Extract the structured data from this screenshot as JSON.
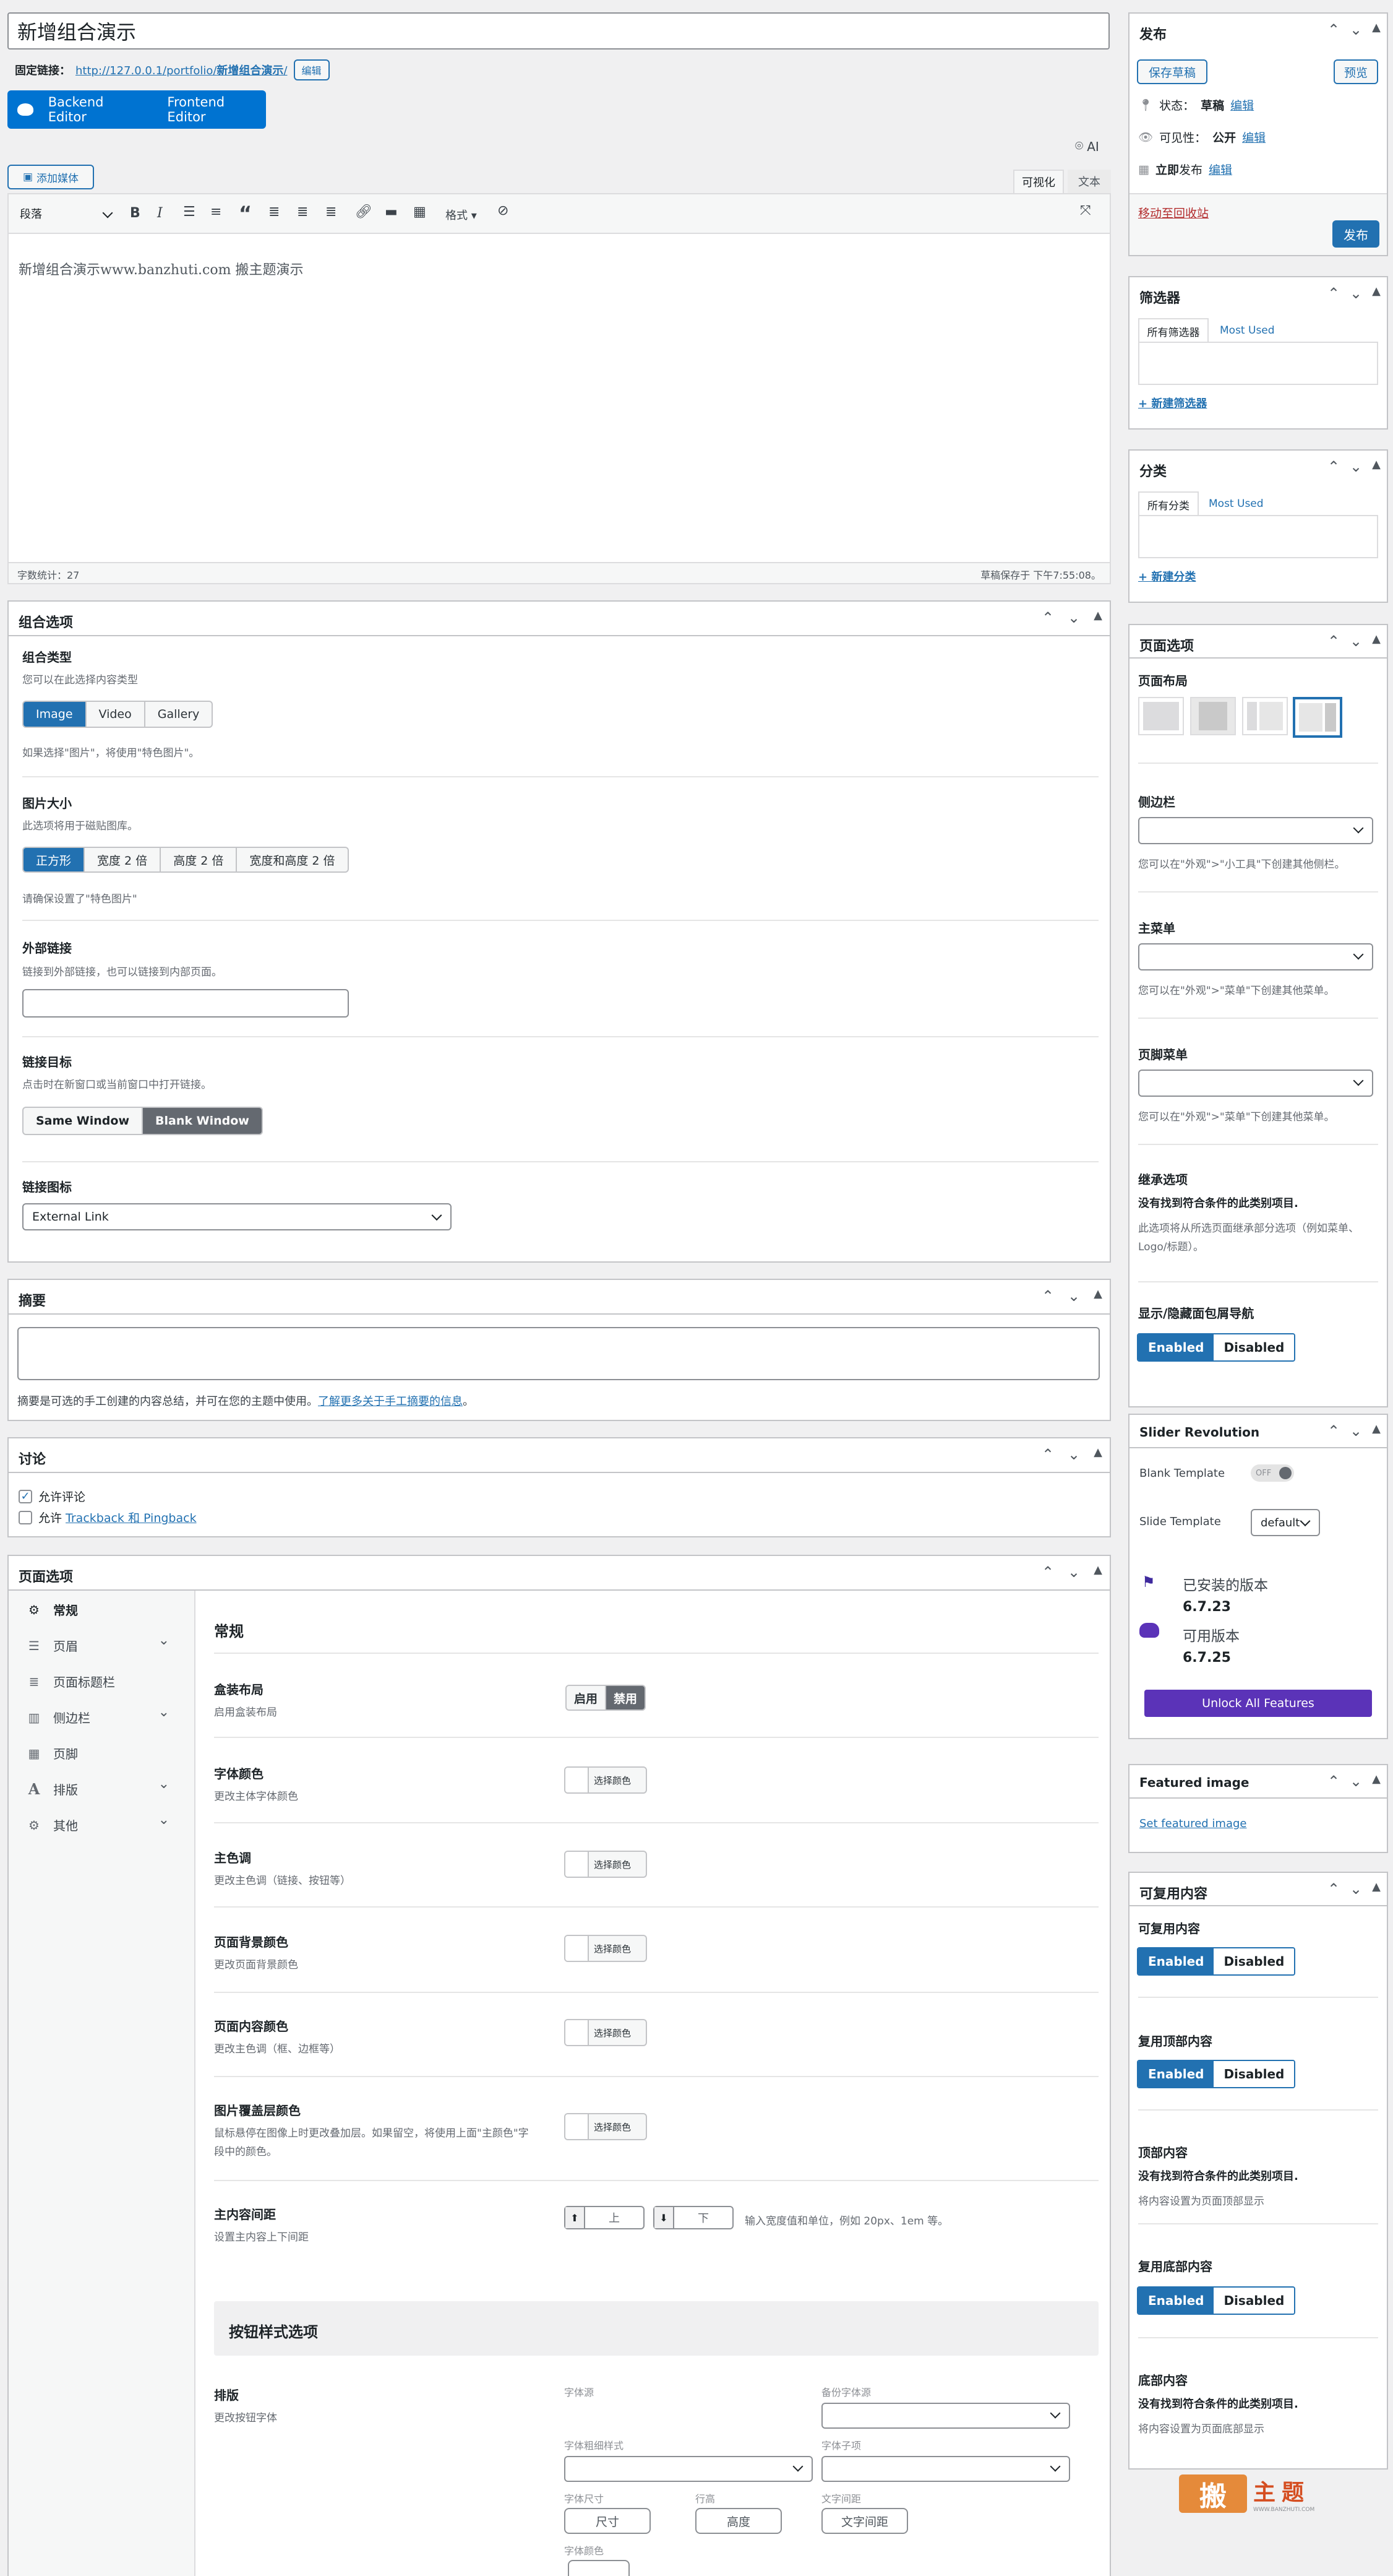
{
  "title_value": "新增组合演示",
  "permalink": {
    "label": "固定链接：",
    "url_prefix": "http://127.0.0.1/portfolio/",
    "url_slug": "新增组合演示",
    "url_suffix": "/",
    "edit": "编辑"
  },
  "builder": {
    "backend": "Backend Editor",
    "frontend": "Frontend Editor",
    "ai": "AI"
  },
  "editor": {
    "add_media": "添加媒体",
    "tab_visual": "可视化",
    "tab_text": "文本",
    "format_select": "段落",
    "more_formats": "格式",
    "content": "新增组合演示www.banzhuti.com 搬主题演示",
    "word_count": "字数统计：27",
    "draft_saved": "草稿保存于 下午7:55:08。"
  },
  "portfolio_options": {
    "title": "组合选项",
    "type": {
      "label": "组合类型",
      "desc": "您可以在此选择内容类型",
      "options": [
        "Image",
        "Video",
        "Gallery"
      ],
      "selected": "Image",
      "note": "如果选择\"图片\"，将使用\"特色图片\"。"
    },
    "image_size": {
      "label": "图片大小",
      "desc": "此选项将用于磁贴图库。",
      "options": [
        "正方形",
        "宽度 2 倍",
        "高度 2 倍",
        "宽度和高度 2 倍"
      ],
      "selected": "正方形",
      "note": "请确保设置了\"特色图片\""
    },
    "external_link": {
      "label": "外部链接",
      "desc": "链接到外部链接，也可以链接到内部页面。",
      "value": ""
    },
    "link_target": {
      "label": "链接目标",
      "desc": "点击时在新窗口或当前窗口中打开链接。",
      "options": [
        "Same Window",
        "Blank Window"
      ],
      "selected": "Blank Window"
    },
    "link_icon": {
      "label": "链接图标",
      "value": "External Link"
    }
  },
  "excerpt": {
    "title": "摘要",
    "help_prefix": "摘要是可选的手工创建的内容总结，并可在您的主题中使用。",
    "help_link": "了解更多关于手工摘要的信息",
    "help_suffix": "。"
  },
  "discussion": {
    "title": "讨论",
    "allow_comments": "允许评论",
    "allow_prefix": "允许 ",
    "allow_link": "Trackback 和 Pingback",
    "comments_checked": true,
    "pings_checked": false
  },
  "page_options_main": {
    "title": "页面选项",
    "nav": [
      {
        "label": "常规",
        "icon": "gear-icon",
        "active": true,
        "chev": false
      },
      {
        "label": "页眉",
        "icon": "sliders-icon",
        "active": false,
        "chev": true
      },
      {
        "label": "页面标题栏",
        "icon": "list-icon",
        "active": false,
        "chev": false
      },
      {
        "label": "侧边栏",
        "icon": "columns-icon",
        "active": false,
        "chev": true
      },
      {
        "label": "页脚",
        "icon": "grid-icon",
        "active": false,
        "chev": false
      },
      {
        "label": "排版",
        "icon": "typography-icon",
        "active": false,
        "chev": true
      },
      {
        "label": "其他",
        "icon": "cog-icon",
        "active": false,
        "chev": true
      }
    ],
    "section_title": "常规",
    "boxed": {
      "label": "盒装布局",
      "desc": "启用盒装布局",
      "on": "启用",
      "off": "禁用"
    },
    "font_color": {
      "label": "字体颜色",
      "desc": "更改主体字体颜色"
    },
    "main_color": {
      "label": "主色调",
      "desc": "更改主色调（链接、按钮等）"
    },
    "bg_color": {
      "label": "页面背景颜色",
      "desc": "更改页面背景颜色"
    },
    "content_color": {
      "label": "页面内容颜色",
      "desc": "更改主色调（框、边框等）"
    },
    "overlay_color": {
      "label": "图片覆盖层颜色",
      "desc": "鼠标悬停在图像上时更改叠加层。如果留空，将使用上面\"主颜色\"字段中的颜色。"
    },
    "color_btn": "选择颜色",
    "spacing": {
      "label": "主内容间距",
      "desc": "设置主内容上下间距",
      "top": "上",
      "bottom": "下",
      "hint": "输入宽度值和单位，例如 20px、1em 等。"
    },
    "btn_style_title": "按钮样式选项",
    "typo": {
      "label": "排版",
      "desc": "更改按钮字体",
      "font_family": "字体源",
      "backup_font": "备份字体源",
      "font_weight": "字体粗细样式",
      "font_subset": "字体子项",
      "font_size": "字体尺寸",
      "line_height": "行高",
      "letter_spacing": "文字间距",
      "font_color": "字体颜色",
      "size_ph": "尺寸",
      "height_ph": "高度",
      "spacing_ph": "文字间距"
    }
  },
  "publish": {
    "title": "发布",
    "save_draft": "保存草稿",
    "preview": "预览",
    "status_label": "状态：",
    "status_value": "草稿",
    "visibility_label": "可见性：",
    "visibility_value": "公开",
    "schedule_value": "立即",
    "schedule_suffix": "发布",
    "edit": "编辑",
    "trash": "移动至回收站",
    "publish": "发布"
  },
  "filters": {
    "title": "筛选器",
    "tab_all": "所有筛选器",
    "tab_used": "Most Used",
    "add": "+ 新建筛选器"
  },
  "categories": {
    "title": "分类",
    "tab_all": "所有分类",
    "tab_used": "Most Used",
    "add": "+ 新建分类"
  },
  "page_options_side": {
    "title": "页面选项",
    "layout_label": "页面布局",
    "sidebar_label": "侧边栏",
    "sidebar_desc": "您可以在\"外观\">\"小工具\"下创建其他侧栏。",
    "menu_label": "主菜单",
    "menu_desc": "您可以在\"外观\">\"菜单\"下创建其他菜单。",
    "footer_menu_label": "页脚菜单",
    "footer_menu_desc": "您可以在\"外观\">\"菜单\"下创建其他菜单。",
    "inherit_label": "继承选项",
    "inherit_bold": "没有找到符合条件的此类别项目.",
    "inherit_desc": "此选项将从所选页面继承部分选项（例如菜单、Logo/标题）。",
    "breadcrumb_label": "显示/隐藏面包屑导航",
    "enabled": "Enabled",
    "disabled": "Disabled"
  },
  "slider": {
    "title": "Slider Revolution",
    "blank_label": "Blank Template",
    "toggle": "OFF",
    "slide_label": "Slide Template",
    "slide_value": "default",
    "installed_label": "已安装的版本",
    "installed_ver": "6.7.23",
    "available_label": "可用版本",
    "available_ver": "6.7.25",
    "unlock": "Unlock All Features"
  },
  "featured": {
    "title": "Featured image",
    "link": "Set featured image"
  },
  "reusable": {
    "title": "可复用内容",
    "l1": "可复用内容",
    "l2": "复用顶部内容",
    "l3": "顶部内容",
    "l3_bold": "没有找到符合条件的此类别项目.",
    "l3_desc": "将内容设置为页面顶部显示",
    "l4": "复用底部内容",
    "l5": "底部内容",
    "l5_bold": "没有找到符合条件的此类别项目.",
    "l5_desc": "将内容设置为页面底部显示",
    "enabled": "Enabled",
    "disabled": "Disabled"
  },
  "watermark": {
    "char": "搬",
    "text": "主题",
    "sub": "WWW.BANZHUTI.COM"
  },
  "colors": {
    "accent": "#2271b1",
    "purple": "#5b33b8",
    "orange": "#d54e21"
  }
}
